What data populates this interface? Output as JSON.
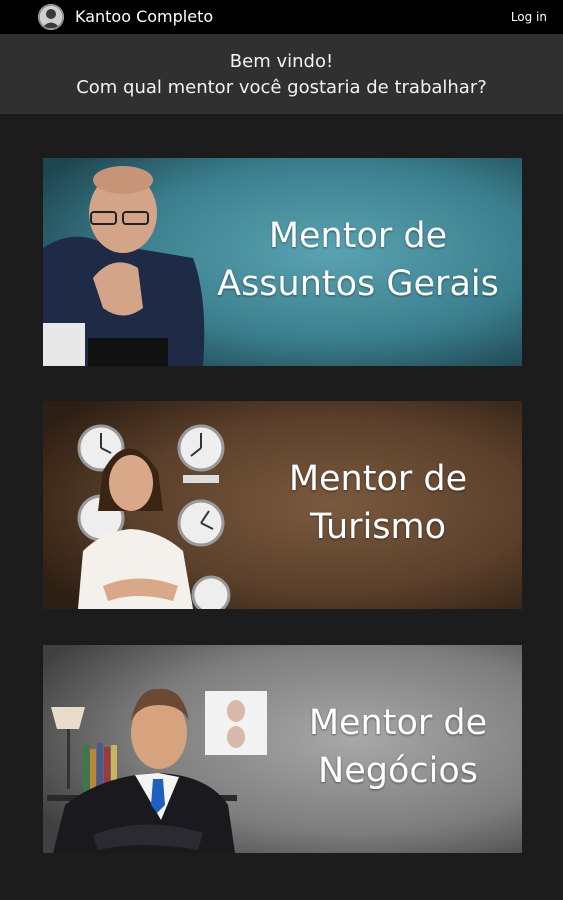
{
  "action_bar": {
    "app_icon": "mentor-logo-icon",
    "title": "Kantoo Completo",
    "login_label": "Log in"
  },
  "welcome": {
    "line1": "Bem vindo!",
    "line2": "Com qual mentor você gostaria de trabalhar?"
  },
  "mentors": [
    {
      "line1": "Mentor de",
      "line2": "Assuntos Gerais",
      "image": "bald-man-with-glasses-thinking",
      "background_color": "#3b7f8e"
    },
    {
      "line1": "Mentor de",
      "line2": "Turismo",
      "image": "smiling-woman-with-wall-clocks",
      "background_color": "#5a3f2a"
    },
    {
      "line1": "Mentor de",
      "line2": "Negócios",
      "image": "businessman-with-lamp-and-books",
      "background_color": "#7d7d7d"
    }
  ],
  "colors": {
    "action_bar": "#000000",
    "header_bar": "#303030",
    "background": "#1c1c1c",
    "text": "#ffffff"
  }
}
